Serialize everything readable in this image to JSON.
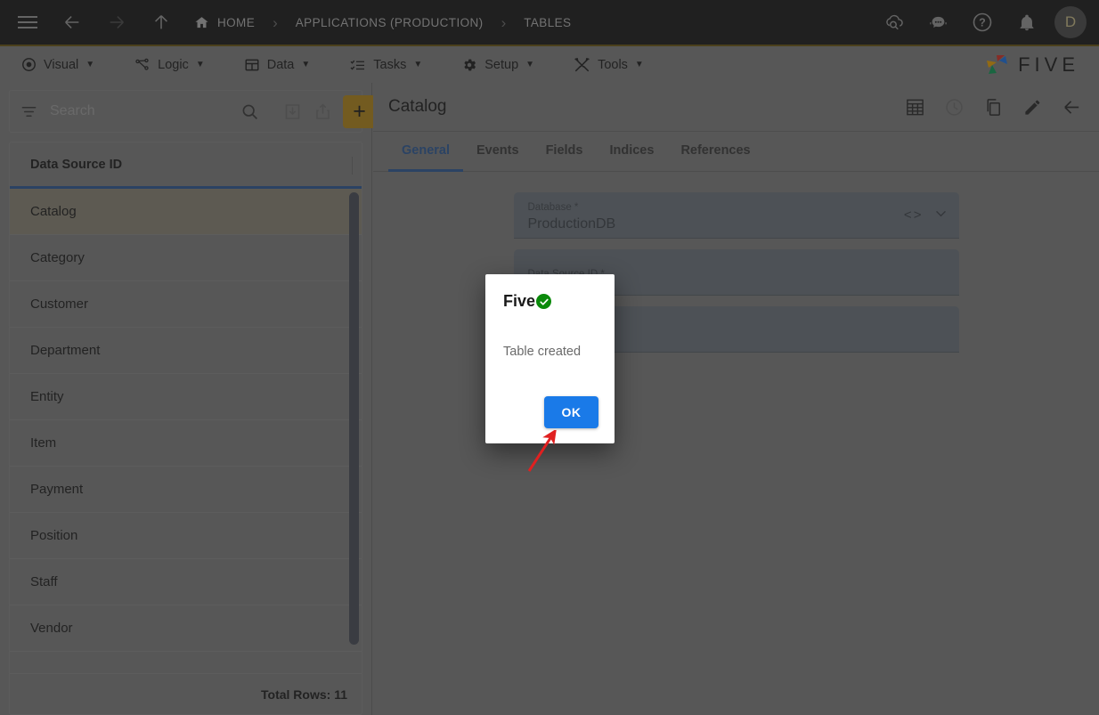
{
  "topbar": {
    "menu_icon": "hamburger-icon",
    "nav": [
      {
        "name": "back-button",
        "icon": "arrow-left-icon",
        "enabled": true
      },
      {
        "name": "forward-button",
        "icon": "arrow-right-icon",
        "enabled": false
      },
      {
        "name": "up-button",
        "icon": "arrow-up-icon",
        "enabled": true
      }
    ],
    "breadcrumbs": [
      {
        "label": "HOME",
        "icon": "home-icon"
      },
      {
        "label": "APPLICATIONS (PRODUCTION)",
        "icon": ""
      },
      {
        "label": "TABLES",
        "icon": ""
      }
    ],
    "separator": "›",
    "actions": [
      {
        "name": "cloud-search-icon",
        "label": ""
      },
      {
        "name": "chat-bot-icon",
        "label": ""
      },
      {
        "name": "help-icon",
        "label": ""
      },
      {
        "name": "notifications-bell-icon",
        "label": ""
      }
    ],
    "avatar_initial": "D"
  },
  "menubar": {
    "items": [
      {
        "label": "Visual",
        "icon": "eye-icon",
        "caret": "▼"
      },
      {
        "label": "Logic",
        "icon": "logic-nodes-icon",
        "caret": "▼"
      },
      {
        "label": "Data",
        "icon": "table-icon",
        "caret": "▼"
      },
      {
        "label": "Tasks",
        "icon": "checklist-icon",
        "caret": "▼"
      },
      {
        "label": "Setup",
        "icon": "gear-icon",
        "caret": "▼"
      },
      {
        "label": "Tools",
        "icon": "tools-icon",
        "caret": "▼"
      }
    ],
    "brand": "FIVE"
  },
  "sidebar": {
    "search": {
      "placeholder": "Search",
      "value": ""
    },
    "toolbar": [
      {
        "name": "filter-icon"
      },
      {
        "name": "search-icon"
      },
      {
        "name": "import-icon"
      },
      {
        "name": "export-icon"
      },
      {
        "name": "add-button",
        "label": "+"
      }
    ],
    "column_header": "Data Source ID",
    "rows": [
      {
        "label": "Catalog",
        "selected": true
      },
      {
        "label": "Category",
        "selected": false
      },
      {
        "label": "Customer",
        "selected": false
      },
      {
        "label": "Department",
        "selected": false
      },
      {
        "label": "Entity",
        "selected": false
      },
      {
        "label": "Item",
        "selected": false
      },
      {
        "label": "Payment",
        "selected": false
      },
      {
        "label": "Position",
        "selected": false
      },
      {
        "label": "Staff",
        "selected": false
      },
      {
        "label": "Vendor",
        "selected": false
      }
    ],
    "footer": "Total Rows: 11"
  },
  "main": {
    "title": "Catalog",
    "tools": [
      {
        "name": "table-grid-icon"
      },
      {
        "name": "history-clock-icon"
      },
      {
        "name": "copy-icon"
      },
      {
        "name": "edit-pencil-icon"
      },
      {
        "name": "back-arrow-icon"
      }
    ],
    "tabs": [
      {
        "label": "General",
        "active": true
      },
      {
        "label": "Events",
        "active": false
      },
      {
        "label": "Fields",
        "active": false
      },
      {
        "label": "Indices",
        "active": false
      },
      {
        "label": "References",
        "active": false
      }
    ],
    "fields": [
      {
        "label": "Database *",
        "value": "ProductionDB",
        "has_icons": true
      },
      {
        "label": "Data Source ID *",
        "value": "",
        "has_icons": false
      },
      {
        "label": "",
        "value": "",
        "has_icons": false
      }
    ]
  },
  "dialog": {
    "title": "Five",
    "status_icon": "success-check-icon",
    "message": "Table created",
    "ok_label": "OK"
  },
  "colors": {
    "accent_blue": "#2e5c9a",
    "button_blue": "#1a7ae8",
    "add_yellow": "#b5891a",
    "success_green": "#0b8a0b",
    "pointer_red": "#e02020",
    "panel_gray": "#808080",
    "topbar_dark": "#1a1a1a"
  }
}
